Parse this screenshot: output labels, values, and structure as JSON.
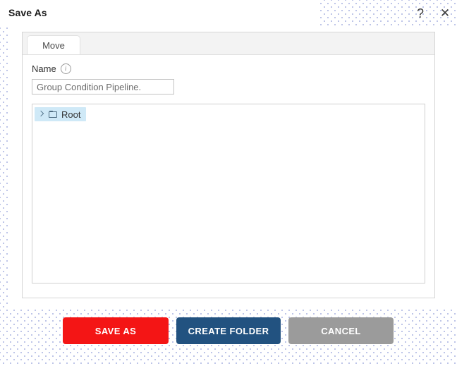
{
  "window": {
    "title": "Save As",
    "help_icon": "question-mark-icon",
    "help_glyph": "?",
    "close_icon": "close-icon",
    "close_glyph": "✕"
  },
  "panel": {
    "tabs": [
      {
        "label": "Move",
        "active": true
      }
    ],
    "form": {
      "name_label": "Name",
      "info_icon": "info-icon",
      "info_glyph": "i",
      "name_value": "Group Condition Pipeline.",
      "name_placeholder": "Name"
    },
    "tree": {
      "items": [
        {
          "label": "Root",
          "expander_icon": "chevron-right-icon",
          "type_icon": "folder-icon",
          "selected": true,
          "expanded": false
        }
      ]
    }
  },
  "footer": {
    "buttons": [
      {
        "label": "SAVE AS",
        "color": "#f41515"
      },
      {
        "label": "CREATE FOLDER",
        "color": "#225280"
      },
      {
        "label": "CANCEL",
        "color": "#9b9b9b"
      }
    ]
  },
  "theme": {
    "dot_pattern_color": "#a8b2e0",
    "selection_color": "#cfe9f7",
    "tab_bar_color": "#f3f3f3"
  }
}
